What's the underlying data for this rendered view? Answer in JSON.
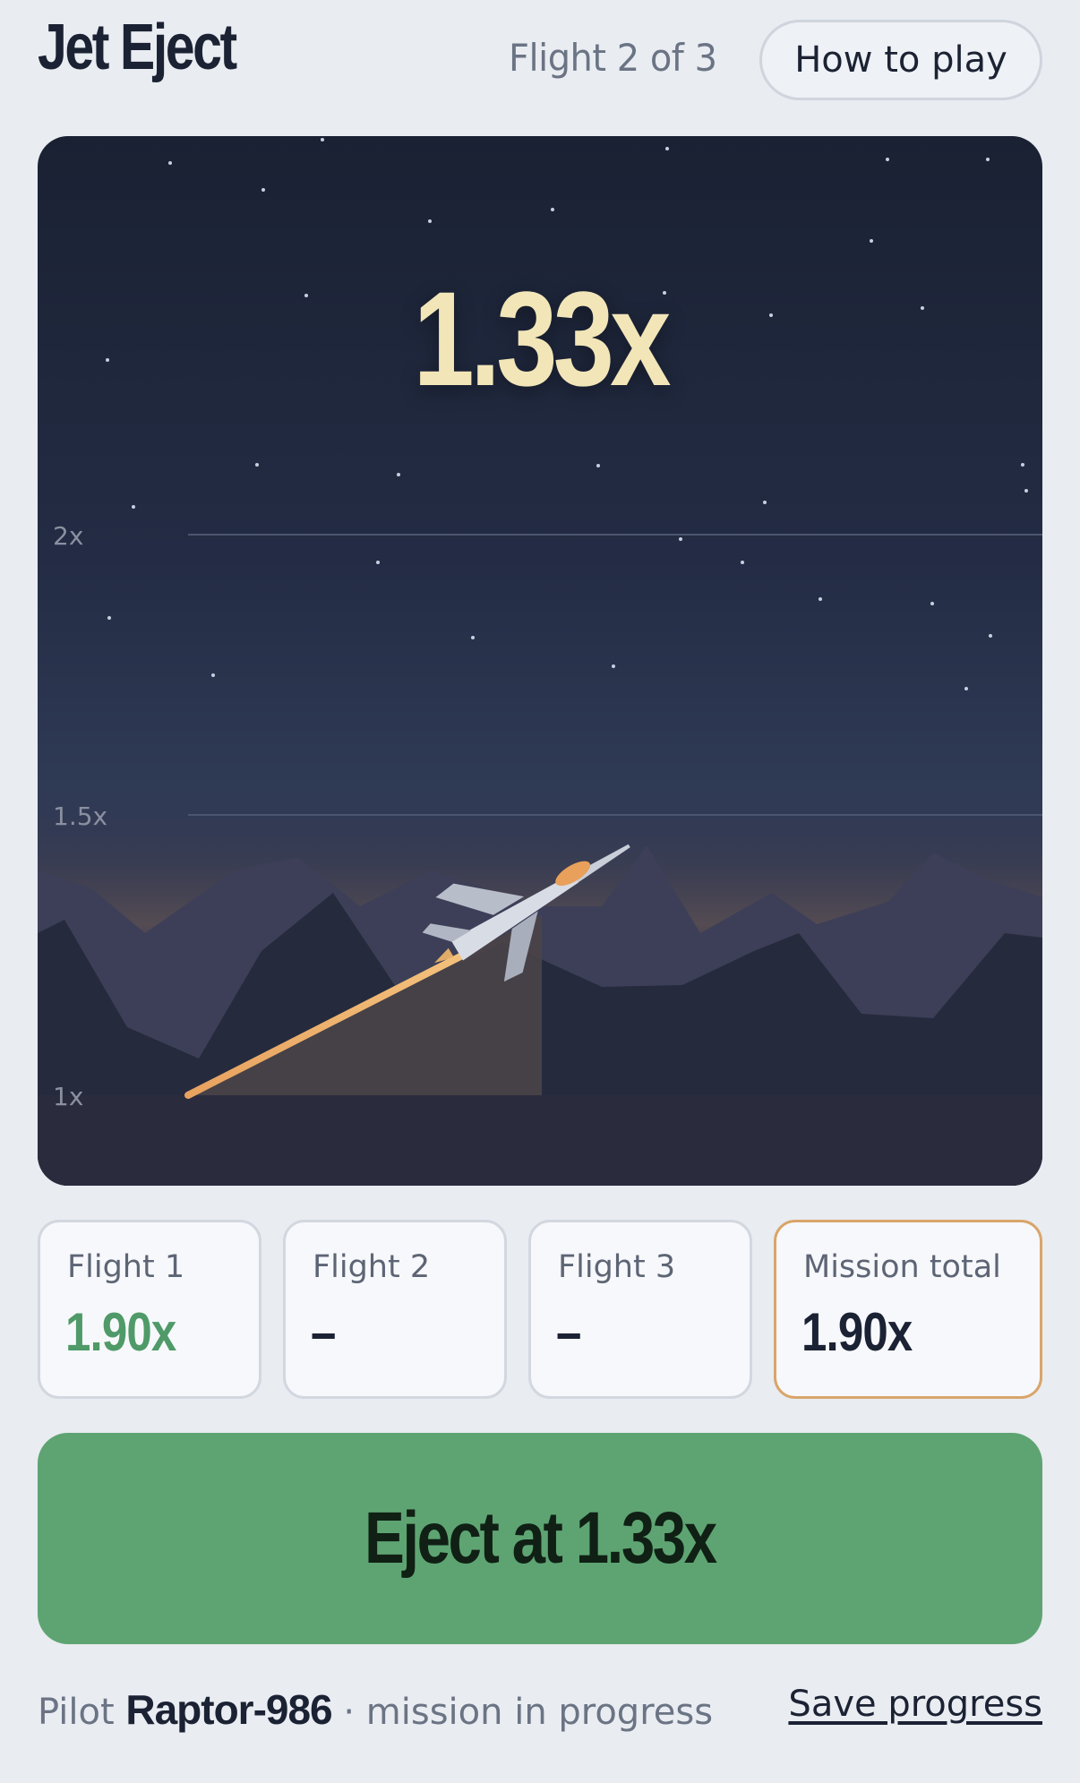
{
  "header": {
    "title": "Jet Eject",
    "flight_status": "Flight 2 of 3",
    "how_to_play_label": "How to play"
  },
  "game": {
    "current_multiplier": "1.33x",
    "current_multiplier_value": 1.33,
    "axis_labels": [
      "2x",
      "1.5x",
      "1x"
    ]
  },
  "flights": [
    {
      "label": "Flight 1",
      "value": "1.90x",
      "value_color": "#4f9a68"
    },
    {
      "label": "Flight 2",
      "value": "–"
    },
    {
      "label": "Flight 3",
      "value": "–"
    }
  ],
  "mission_total": {
    "label": "Mission total",
    "value": "1.90x",
    "accent": "#d9a56a"
  },
  "eject_button": {
    "label": "Eject at 1.33x",
    "color": "#5ea472"
  },
  "footer": {
    "pilot_prefix": "Pilot",
    "pilot_name": "Raptor-986",
    "status": "· mission in progress",
    "save_label": "Save progress"
  }
}
